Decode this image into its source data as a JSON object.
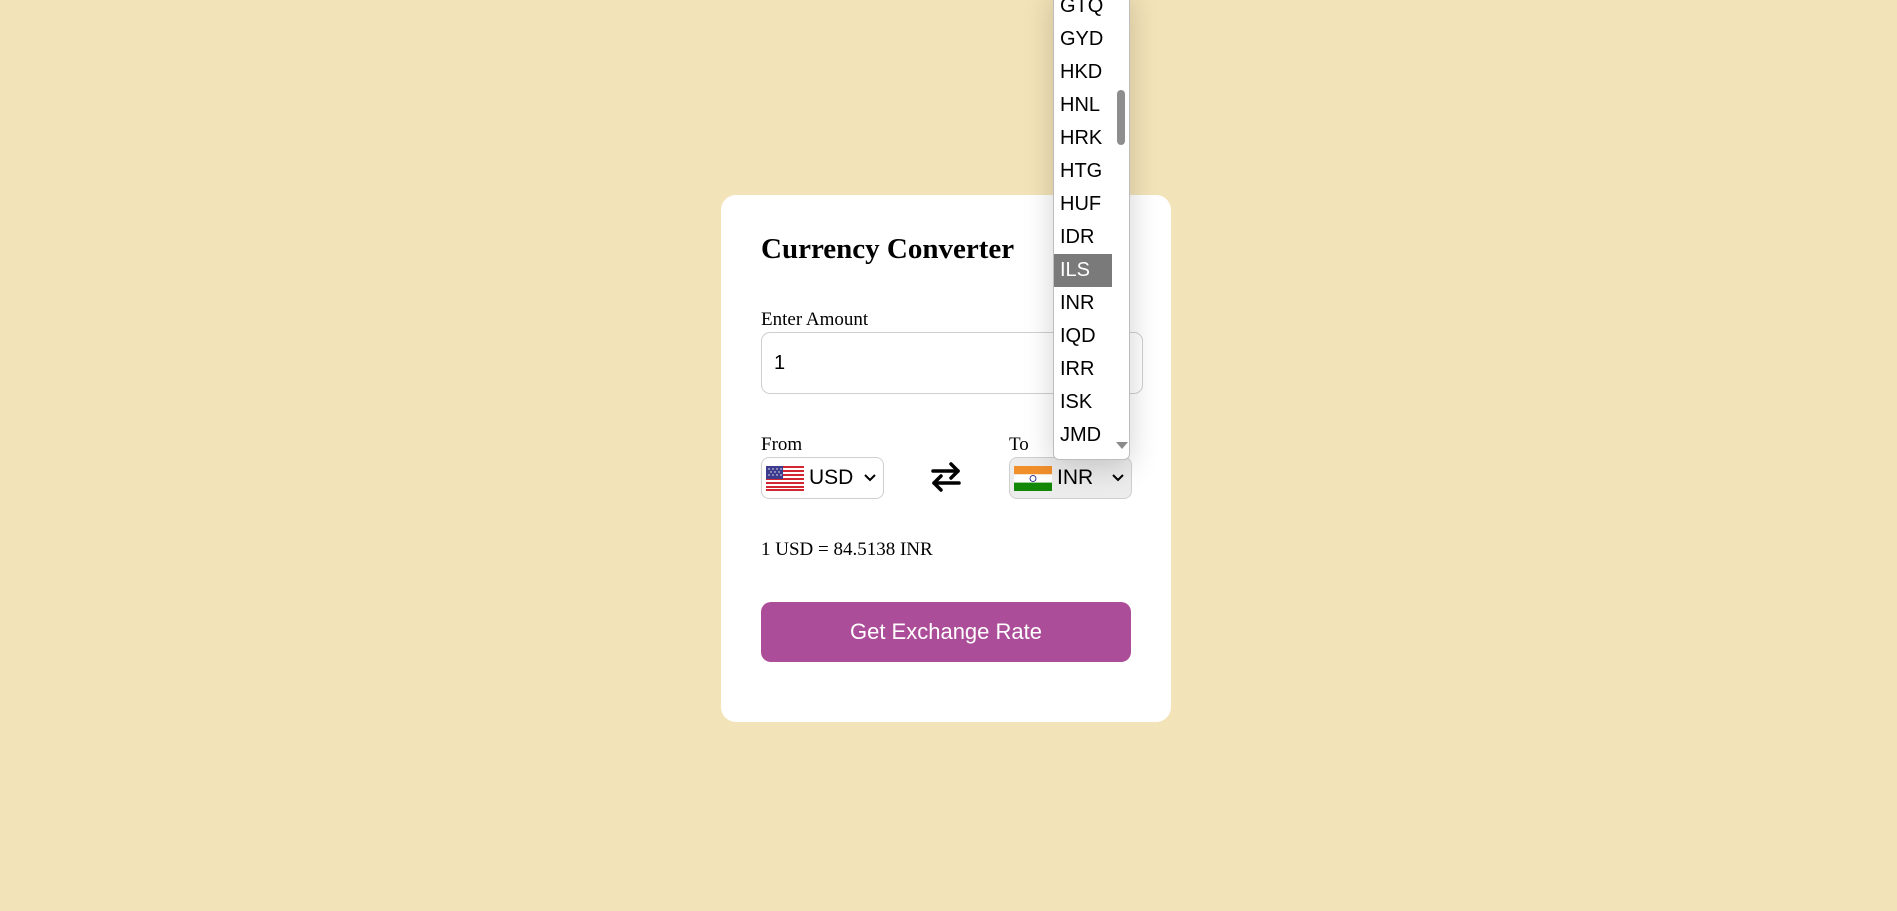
{
  "card": {
    "title": "Currency Converter",
    "amount_label": "Enter Amount",
    "amount_value": "1",
    "from_label": "From",
    "to_label": "To",
    "from_currency": "USD",
    "to_currency": "INR",
    "from_flag_icon": "us-flag-icon",
    "to_flag_icon": "india-flag-icon",
    "swap_icon": "swap-arrows-icon",
    "rate_text": "1 USD = 84.5138 INR",
    "button_label": "Get Exchange Rate"
  },
  "dropdown": {
    "options": [
      "GTQ",
      "GYD",
      "HKD",
      "HNL",
      "HRK",
      "HTG",
      "HUF",
      "IDR",
      "ILS",
      "INR",
      "IQD",
      "IRR",
      "ISK",
      "JMD"
    ],
    "highlighted": "ILS"
  },
  "colors": {
    "background": "#f3e3b8",
    "card": "#ffffff",
    "button": "#ab4d99",
    "highlight": "#7a7a7a"
  }
}
